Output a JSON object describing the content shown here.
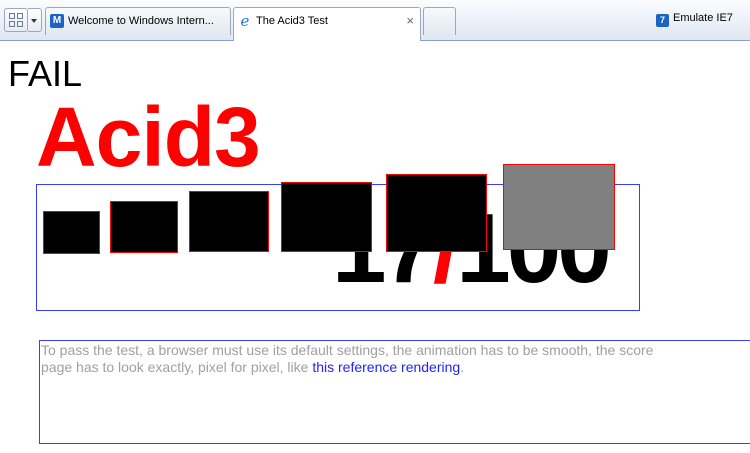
{
  "browser": {
    "tabs": [
      {
        "label": "Welcome to Windows Intern...",
        "active": false
      },
      {
        "label": "The Acid3 Test",
        "active": true
      }
    ],
    "close_glyph": "×",
    "emulate": {
      "icon_text": "7",
      "label": "Emulate IE7"
    },
    "colors": {
      "tabbar": "#dfe7f3",
      "tab_border": "#9aa9c0"
    }
  },
  "page": {
    "status": "FAIL",
    "title": "Acid3",
    "score": {
      "value": "17",
      "slash": "/",
      "total": "100"
    },
    "note": {
      "line1": "To pass the test, a browser must use its default settings, the animation has to be smooth, the score",
      "line2": "page has to look exactly, pixel for pixel, like ",
      "link_text": "this reference rendering",
      "after_link": "."
    },
    "colors": {
      "title": "#ff0000",
      "box_border": "#3b3bff",
      "bucket_border": "#ff0000",
      "note_text": "#a0a0a0",
      "link": "#2222ff"
    }
  }
}
